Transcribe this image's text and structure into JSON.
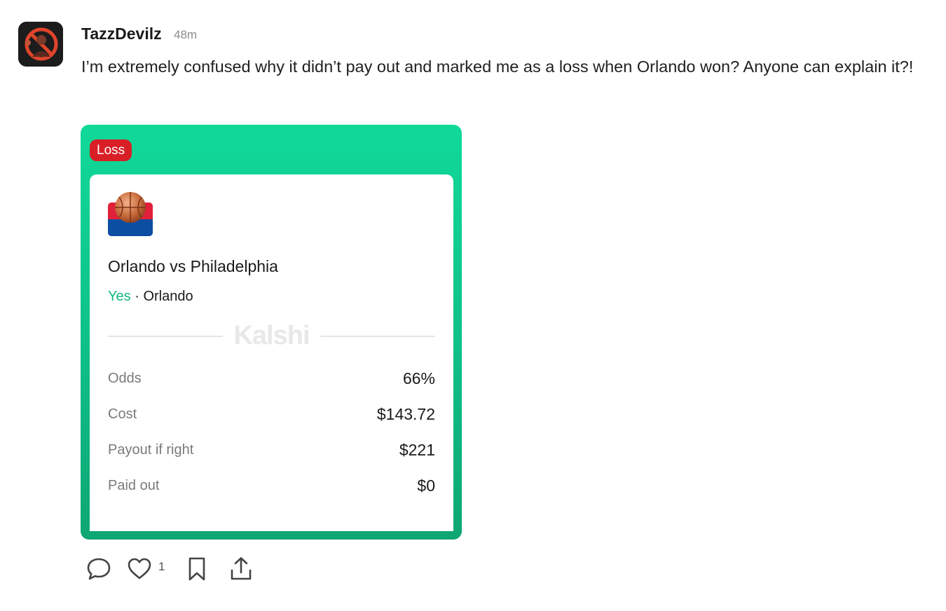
{
  "post": {
    "username": "TazzDevilz",
    "timestamp": "48m",
    "text": "I’m extremely confused why it didn’t pay out and marked me as a loss when Orlando won? Anyone can explain it?!"
  },
  "card": {
    "result_badge": "Loss",
    "matchup": "Orlando vs Philadelphia",
    "pick_side": "Yes",
    "pick_separator": "·",
    "pick_team": "Orlando",
    "brand": "Kalshi",
    "stats": [
      {
        "label": "Odds",
        "value": "66%"
      },
      {
        "label": "Cost",
        "value": "$143.72"
      },
      {
        "label": "Payout if right",
        "value": "$221"
      },
      {
        "label": "Paid out",
        "value": "$0"
      }
    ]
  },
  "actions": {
    "like_count": "1",
    "icons": [
      "comment-icon",
      "heart-icon",
      "bookmark-icon",
      "share-icon"
    ]
  },
  "colors": {
    "card_green": "#10d998",
    "loss_red": "#d81f26",
    "yes_green": "#14b97c"
  }
}
